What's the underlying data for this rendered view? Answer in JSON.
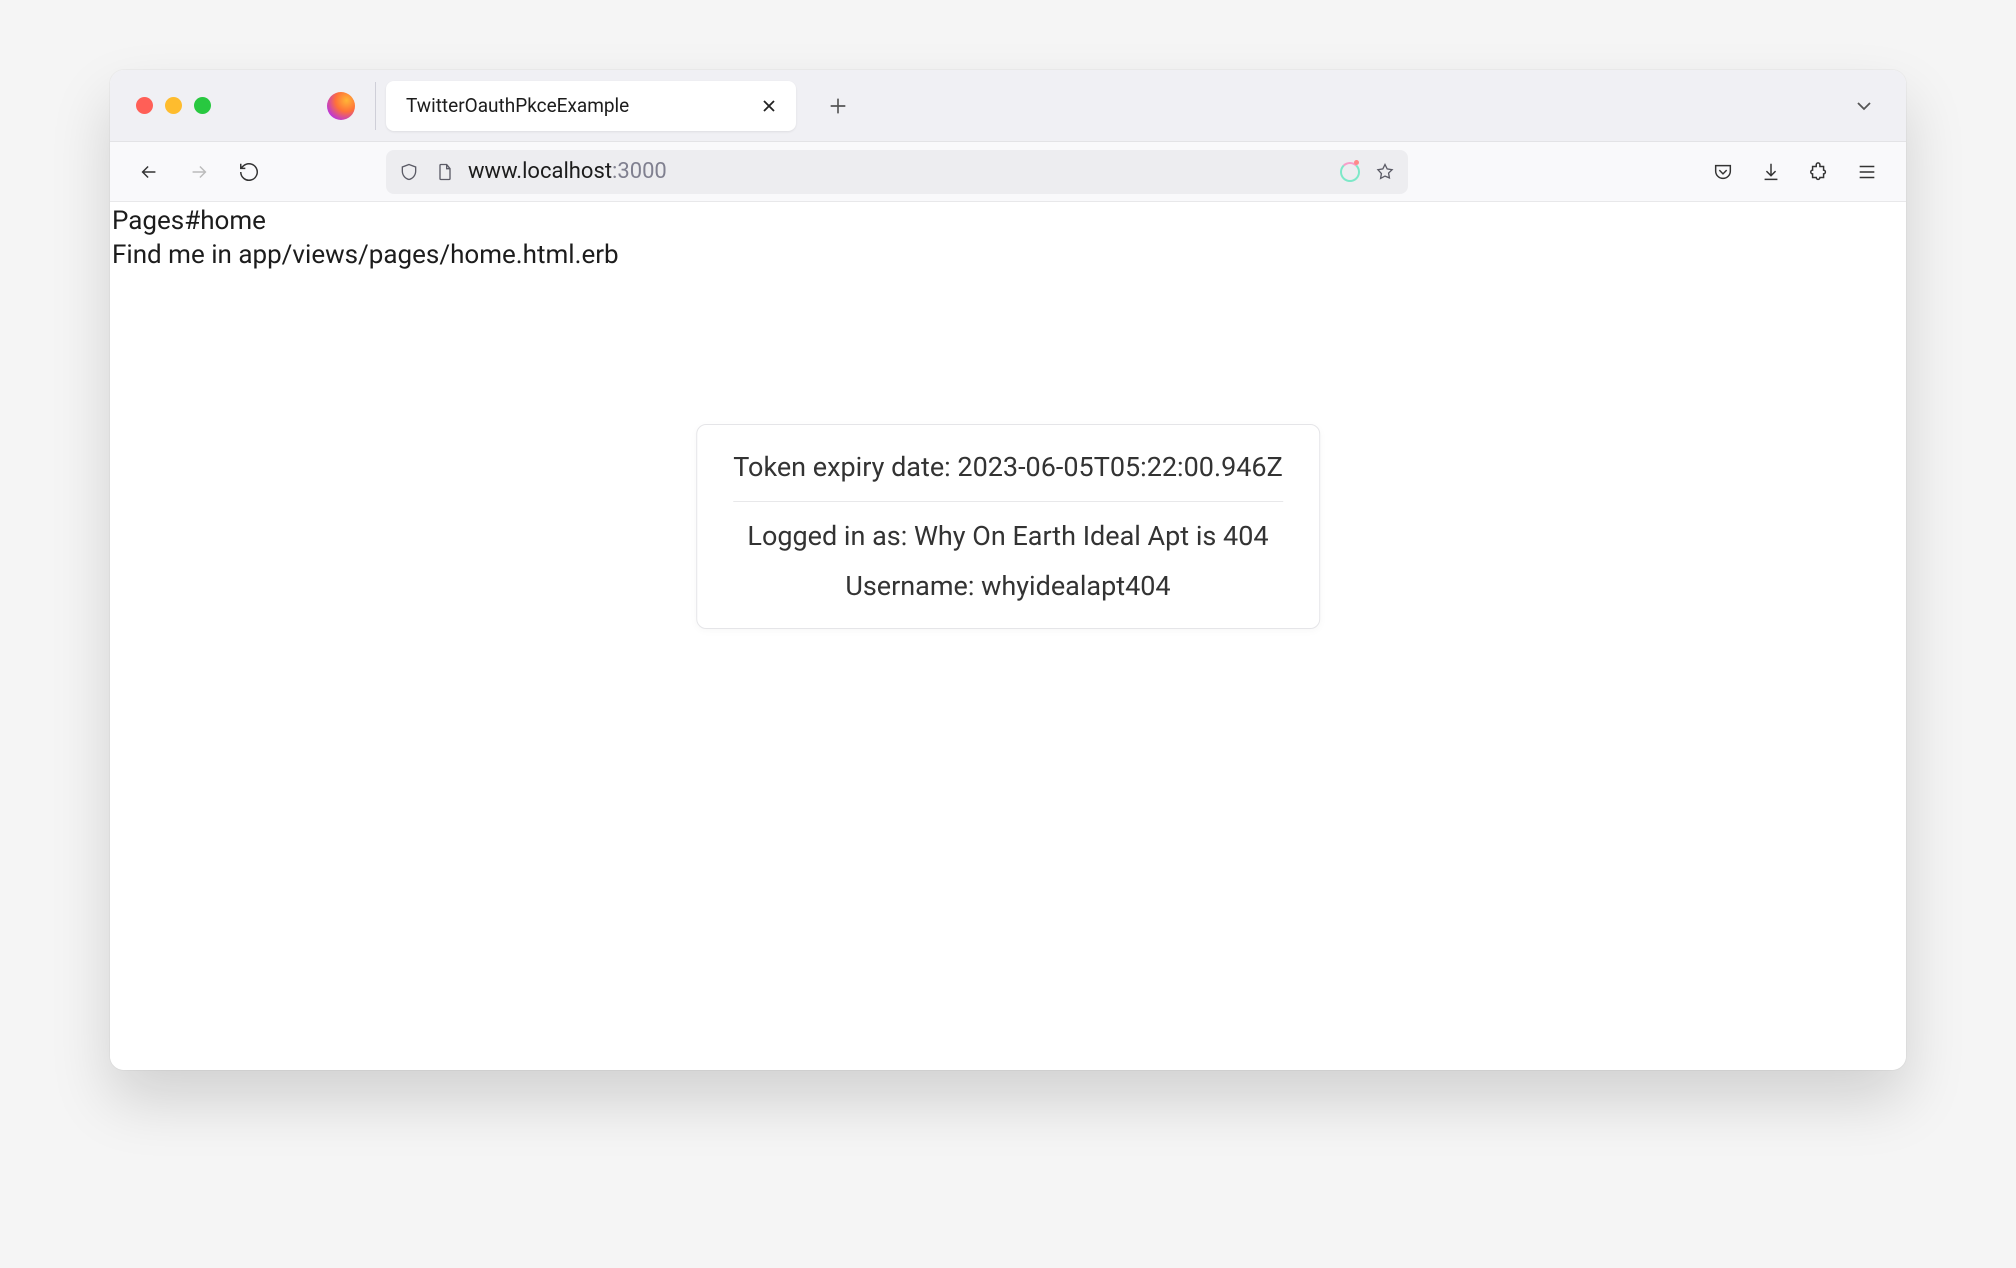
{
  "browser": {
    "tab_title": "TwitterOauthPkceExample",
    "url_host": "www.localhost",
    "url_port": ":3000"
  },
  "page": {
    "heading": "Pages#home",
    "subtext": "Find me in app/views/pages/home.html.erb"
  },
  "card": {
    "token_expiry_label": "Token expiry date:",
    "token_expiry_value": "2023-06-05T05:22:00.946Z",
    "logged_in_label": "Logged in as:",
    "logged_in_value": "Why On Earth Ideal Apt is 404",
    "username_label": "Username:",
    "username_value": "whyidealapt404"
  }
}
